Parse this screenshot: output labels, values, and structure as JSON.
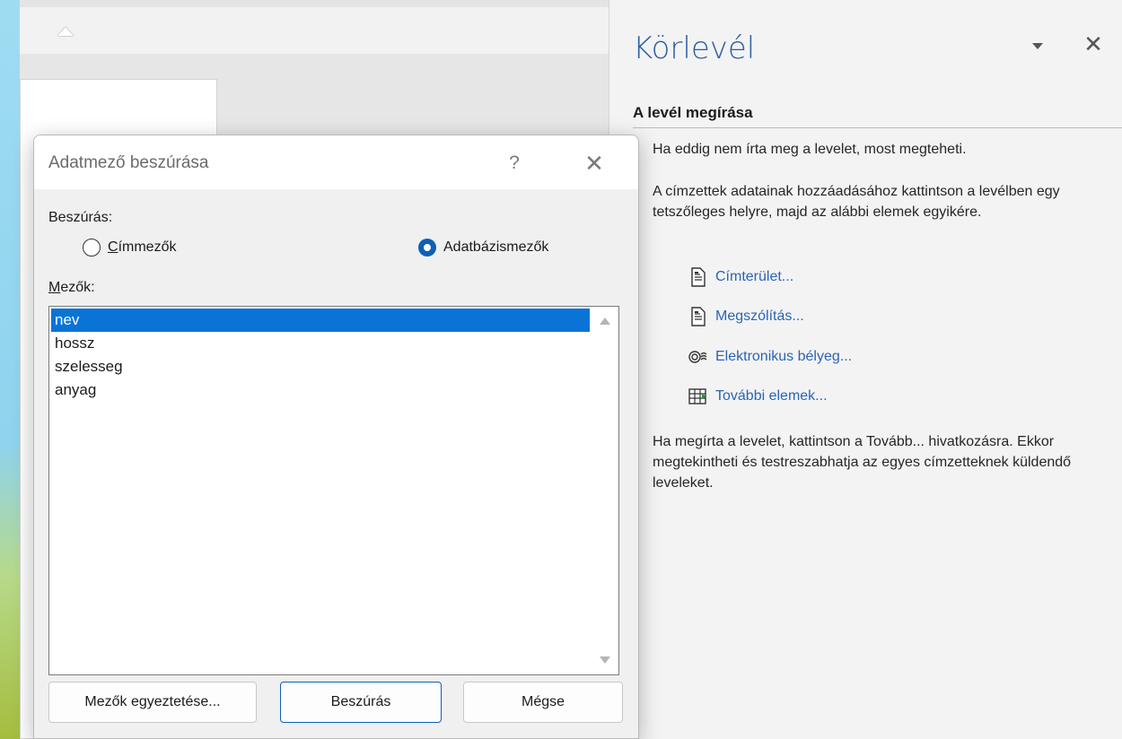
{
  "document": {
    "ruler_ticks": "· ⌂ · ı · ı · ı · ı · ı · ı"
  },
  "task_pane": {
    "title": "Körlevél",
    "section_heading": "A levél megírása",
    "intro": "Ha eddig nem írta meg a levelet, most megteheti.",
    "instructions": "A címzettek adatainak hozzáadásához kattintson a levélben egy tetszőleges helyre, majd az alábbi elemek egyikére.",
    "links": [
      {
        "label": "Címterület...",
        "icon": "document-icon"
      },
      {
        "label": "Megszólítás...",
        "icon": "document-icon"
      },
      {
        "label": "Elektronikus bélyeg...",
        "icon": "postage-icon"
      },
      {
        "label": "További elemek...",
        "icon": "table-icon"
      }
    ],
    "footer": "Ha megírta a levelet, kattintson a Tovább... hivatkozásra. Ekkor megtekintheti és testreszabhatja az egyes címzetteknek küldendő leveleket.",
    "accent_color": "#2e5fa3",
    "link_color": "#2a64b6"
  },
  "dialog": {
    "title": "Adatmező beszúrása",
    "help": "?",
    "insert_label": "Beszúrás:",
    "radio_address": {
      "label": "Címmezők",
      "checked": false
    },
    "radio_database": {
      "label": "Adatbázismezők",
      "checked": true
    },
    "fields_label": "Mezők:",
    "fields": [
      "nev",
      "hossz",
      "szelesseg",
      "anyag"
    ],
    "selected_field": "nev",
    "buttons": {
      "match": "Mezők egyeztetése...",
      "insert": "Beszúrás",
      "cancel": "Mégse"
    },
    "selection_color": "#0a74d6"
  }
}
